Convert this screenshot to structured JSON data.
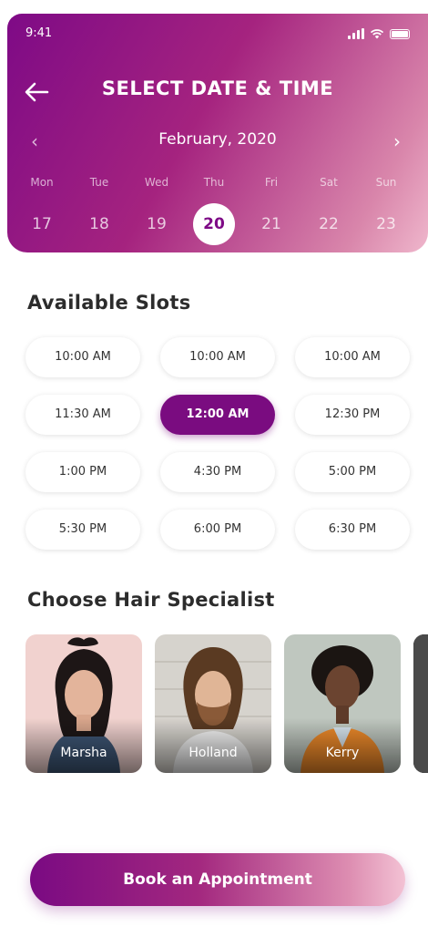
{
  "status": {
    "time": "9:41"
  },
  "header": {
    "title": "SELECT DATE & TIME"
  },
  "calendar": {
    "month": "February, 2020",
    "days": [
      {
        "name": "Mon",
        "date": "17"
      },
      {
        "name": "Tue",
        "date": "18"
      },
      {
        "name": "Wed",
        "date": "19"
      },
      {
        "name": "Thu",
        "date": "20"
      },
      {
        "name": "Fri",
        "date": "21"
      },
      {
        "name": "Sat",
        "date": "22"
      },
      {
        "name": "Sun",
        "date": "23"
      }
    ],
    "selected_date": "20"
  },
  "slots": {
    "title": "Available Slots",
    "items": [
      "10:00 AM",
      "10:00 AM",
      "10:00 AM",
      "11:30 AM",
      "12:00 AM",
      "12:30 PM",
      "1:00 PM",
      "4:30 PM",
      "5:00 PM",
      "5:30 PM",
      "6:00 PM",
      "6:30 PM"
    ],
    "selected": "12:00 AM"
  },
  "specialists": {
    "title": "Choose Hair Specialist",
    "items": [
      {
        "name": "Marsha"
      },
      {
        "name": "Holland"
      },
      {
        "name": "Kerry"
      }
    ]
  },
  "cta": {
    "label": "Book an Appointment"
  },
  "colors": {
    "primary": "#7a0c80",
    "gradient_end": "#f3c2d4"
  },
  "icons": {
    "back": "arrow-left-icon",
    "prev": "chevron-left-icon",
    "next": "chevron-right-icon"
  }
}
